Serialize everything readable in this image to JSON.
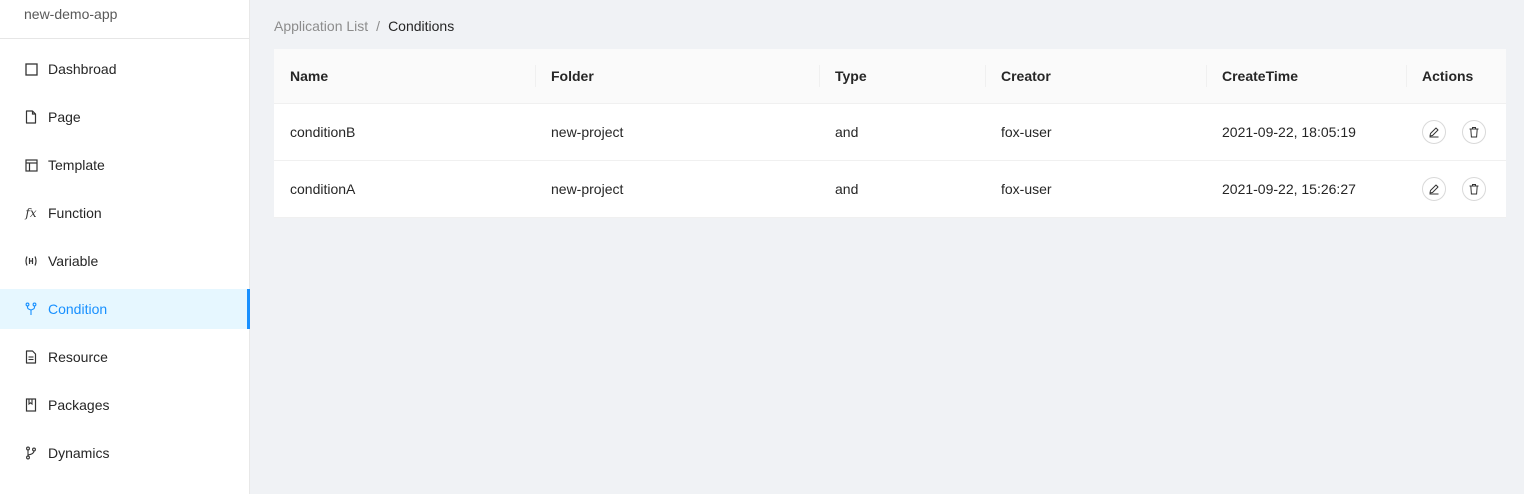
{
  "sidebar": {
    "app_name": "new-demo-app",
    "items": [
      {
        "label": "Dashbroad",
        "icon": "square-icon"
      },
      {
        "label": "Page",
        "icon": "file-icon"
      },
      {
        "label": "Template",
        "icon": "layout-icon"
      },
      {
        "label": "Function",
        "icon": "fx-icon"
      },
      {
        "label": "Variable",
        "icon": "variable-icon"
      },
      {
        "label": "Condition",
        "icon": "branch-fork-icon",
        "active": true
      },
      {
        "label": "Resource",
        "icon": "file-text-icon"
      },
      {
        "label": "Packages",
        "icon": "book-icon"
      },
      {
        "label": "Dynamics",
        "icon": "git-branch-icon"
      }
    ]
  },
  "breadcrumb": {
    "parent": "Application List",
    "separator": "/",
    "current": "Conditions"
  },
  "table": {
    "columns": [
      "Name",
      "Folder",
      "Type",
      "Creator",
      "CreateTime",
      "Actions"
    ],
    "rows": [
      {
        "name": "conditionB",
        "folder": "new-project",
        "type": "and",
        "creator": "fox-user",
        "create_time": "2021-09-22, 18:05:19"
      },
      {
        "name": "conditionA",
        "folder": "new-project",
        "type": "and",
        "creator": "fox-user",
        "create_time": "2021-09-22, 15:26:27"
      }
    ]
  },
  "colors": {
    "accent": "#1890ff",
    "active_bg": "#e6f7ff",
    "page_bg": "#f0f2f5"
  }
}
